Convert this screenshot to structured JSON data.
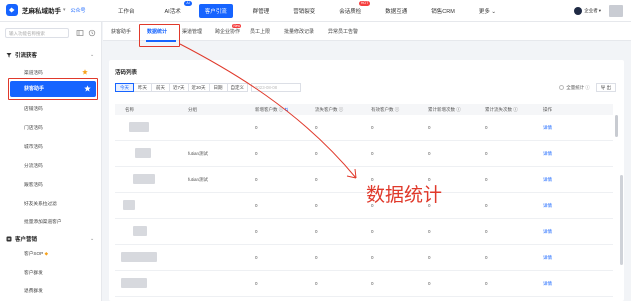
{
  "topbar": {
    "brand": "芝麻私域助手",
    "brand_sub": "公众号",
    "nav": [
      {
        "label": "工作台",
        "badge": ""
      },
      {
        "label": "AI活术",
        "badge": "AI"
      },
      {
        "label": "客户引流",
        "badge": ""
      },
      {
        "label": "群管理",
        "badge": ""
      },
      {
        "label": "营销裂变",
        "badge": ""
      },
      {
        "label": "会话质检",
        "badge": "HOT"
      },
      {
        "label": "数据互通",
        "badge": ""
      },
      {
        "label": "销售CRM",
        "badge": ""
      },
      {
        "label": "更多",
        "badge": ""
      }
    ],
    "user_label": "企业者"
  },
  "sidebar": {
    "search_placeholder": "输入功能名称搜索",
    "group1": "引流获客",
    "group1_items": [
      "渠道活码",
      "获客助手",
      "店铺活码",
      "门店活码",
      "城市活码",
      "分流活码",
      "跟客活码",
      "好友关系拉过滤",
      "批量添加渠道客户"
    ],
    "active_item": "获客助手",
    "group2": "客户营销",
    "group2_items": [
      "客户SOP",
      "客户群发",
      "退费群发"
    ]
  },
  "subtabs": {
    "items": [
      "获客助手",
      "数据统计",
      "渠道管理",
      "跨企业协作",
      "员工上限",
      "批量修改记录",
      "异常员工告警"
    ],
    "active": "数据统计",
    "new_badge": "New"
  },
  "panel": {
    "title": "活码列表",
    "filters": [
      "今天",
      "昨天",
      "前天",
      "近7天",
      "近30天",
      "日期",
      "自定义"
    ],
    "active_filter": "今天",
    "date_placeholder": "2023-08-08",
    "total_label": "全量统计",
    "export_label": "导 出",
    "columns": [
      "名称",
      "分组",
      "新增客户数",
      "流失客户数",
      "有效客户数",
      "累计新增次数",
      "累计流失次数",
      "操作"
    ],
    "rows": [
      {
        "group": "",
        "v1": "0",
        "v2": "0",
        "v3": "0",
        "v4": "0",
        "v5": "0",
        "op": "详情"
      },
      {
        "group": "futian测试",
        "v1": "0",
        "v2": "0",
        "v3": "0",
        "v4": "0",
        "v5": "0",
        "op": "详情"
      },
      {
        "group": "futian测试",
        "v1": "0",
        "v2": "0",
        "v3": "0",
        "v4": "0",
        "v5": "0",
        "op": "详情"
      },
      {
        "group": "",
        "v1": "0",
        "v2": "0",
        "v3": "0",
        "v4": "0",
        "v5": "0",
        "op": "详情"
      },
      {
        "group": "",
        "v1": "0",
        "v2": "0",
        "v3": "0",
        "v4": "0",
        "v5": "0",
        "op": "详情"
      },
      {
        "group": "",
        "v1": "0",
        "v2": "0",
        "v3": "0",
        "v4": "0",
        "v5": "0",
        "op": "详情"
      },
      {
        "group": "",
        "v1": "0",
        "v2": "0",
        "v3": "0",
        "v4": "0",
        "v5": "0",
        "op": "详情"
      },
      {
        "group": "",
        "v1": "0",
        "v2": "0",
        "v3": "0",
        "v4": "0",
        "v5": "0",
        "op": "详情"
      }
    ]
  },
  "annotation": {
    "text": "数据统计"
  },
  "colors": {
    "accent": "#1664ff",
    "annotation_red": "#e0392b"
  }
}
